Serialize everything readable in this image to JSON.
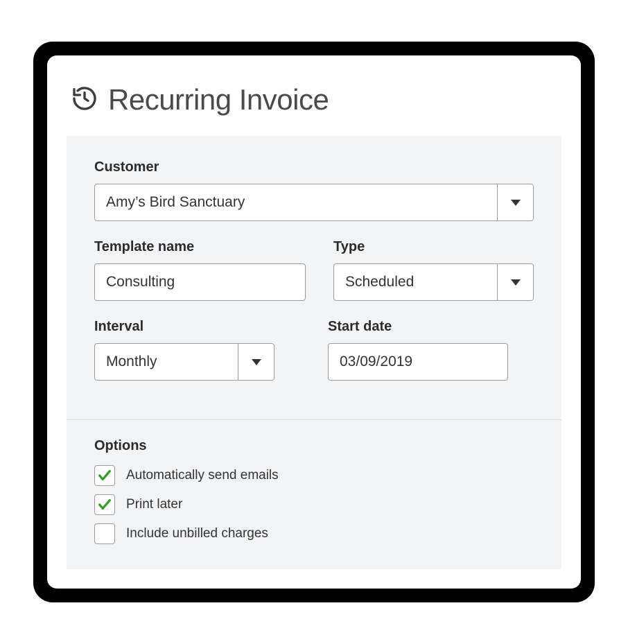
{
  "header": {
    "title": "Recurring Invoice"
  },
  "form": {
    "customer": {
      "label": "Customer",
      "value": "Amy’s Bird Sanctuary"
    },
    "template_name": {
      "label": "Template name",
      "value": "Consulting"
    },
    "type": {
      "label": "Type",
      "value": "Scheduled"
    },
    "interval": {
      "label": "Interval",
      "value": "Monthly"
    },
    "start_date": {
      "label": "Start date",
      "value": "03/09/2019"
    }
  },
  "options": {
    "title": "Options",
    "items": [
      {
        "label": "Automatically send emails",
        "checked": true
      },
      {
        "label": "Print later",
        "checked": true
      },
      {
        "label": "Include unbilled charges",
        "checked": false
      }
    ]
  }
}
